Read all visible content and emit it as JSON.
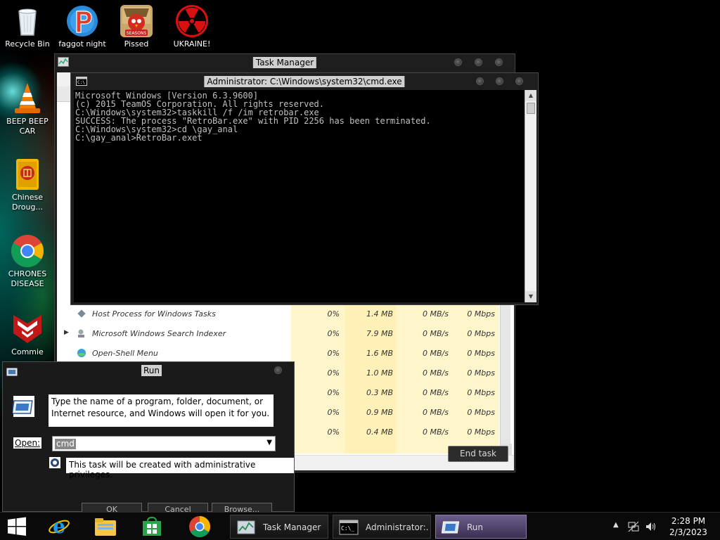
{
  "desktop": {
    "icons": [
      {
        "label": "Recycle Bin"
      },
      {
        "label": "faggot night"
      },
      {
        "label": "Pissed"
      },
      {
        "label": "UKRAINE!"
      },
      {
        "label": "BEEP BEEP\nCAR"
      },
      {
        "label": "Chinese\nDroug..."
      },
      {
        "label": "CHRONES\nDISEASE"
      },
      {
        "label": "Commie"
      }
    ],
    "pissed_icon_text": "SEASONS"
  },
  "task_manager": {
    "title": "Task Manager",
    "rows": [
      {
        "name": "Host Process for Windows Tasks",
        "cpu": "0%",
        "memory": "1.4 MB",
        "disk": "0 MB/s",
        "network": "0 Mbps"
      },
      {
        "name": "Microsoft Windows Search Indexer",
        "cpu": "0%",
        "memory": "7.9 MB",
        "disk": "0 MB/s",
        "network": "0 Mbps"
      },
      {
        "name": "Open-Shell Menu",
        "cpu": "0%",
        "memory": "1.6 MB",
        "disk": "0 MB/s",
        "network": "0 Mbps"
      },
      {
        "name": "",
        "cpu": "0%",
        "memory": "1.0 MB",
        "disk": "0 MB/s",
        "network": "0 Mbps"
      },
      {
        "name": "",
        "cpu": "0%",
        "memory": "0.3 MB",
        "disk": "0 MB/s",
        "network": "0 Mbps"
      },
      {
        "name": "",
        "cpu": "0%",
        "memory": "0.9 MB",
        "disk": "0 MB/s",
        "network": "0 Mbps"
      },
      {
        "name": "",
        "cpu": "0%",
        "memory": "0.4 MB",
        "disk": "0 MB/s",
        "network": "0 Mbps"
      }
    ],
    "end_task_label": "End task"
  },
  "cmd": {
    "title": "Administrator: C:\\Windows\\system32\\cmd.exe",
    "lines": [
      "Microsoft Windows [Version 6.3.9600]",
      "(c) 2015 TeamOS Corporation. All rights reserved.",
      "",
      "C:\\Windows\\system32>taskkill /f /im retrobar.exe",
      "SUCCESS: The process \"RetroBar.exe\" with PID 2256 has been terminated.",
      "",
      "C:\\Windows\\system32>cd \\gay_anal",
      "",
      "C:\\gay_anal>RetroBar.exet"
    ]
  },
  "run": {
    "title": "Run",
    "description": "Type the name of a program, folder, document, or Internet resource, and Windows will open it for you.",
    "open_label": "Open:",
    "open_value": "cmd",
    "admin_note": "This task will be created with administrative privileges.",
    "buttons": [
      "OK",
      "Cancel",
      "Browse..."
    ]
  },
  "taskbar": {
    "tasks": [
      {
        "label": "Task Manager"
      },
      {
        "label": "Administrator:..."
      },
      {
        "label": "Run"
      }
    ],
    "clock_time": "2:28 PM",
    "clock_date": "2/3/2023"
  }
}
